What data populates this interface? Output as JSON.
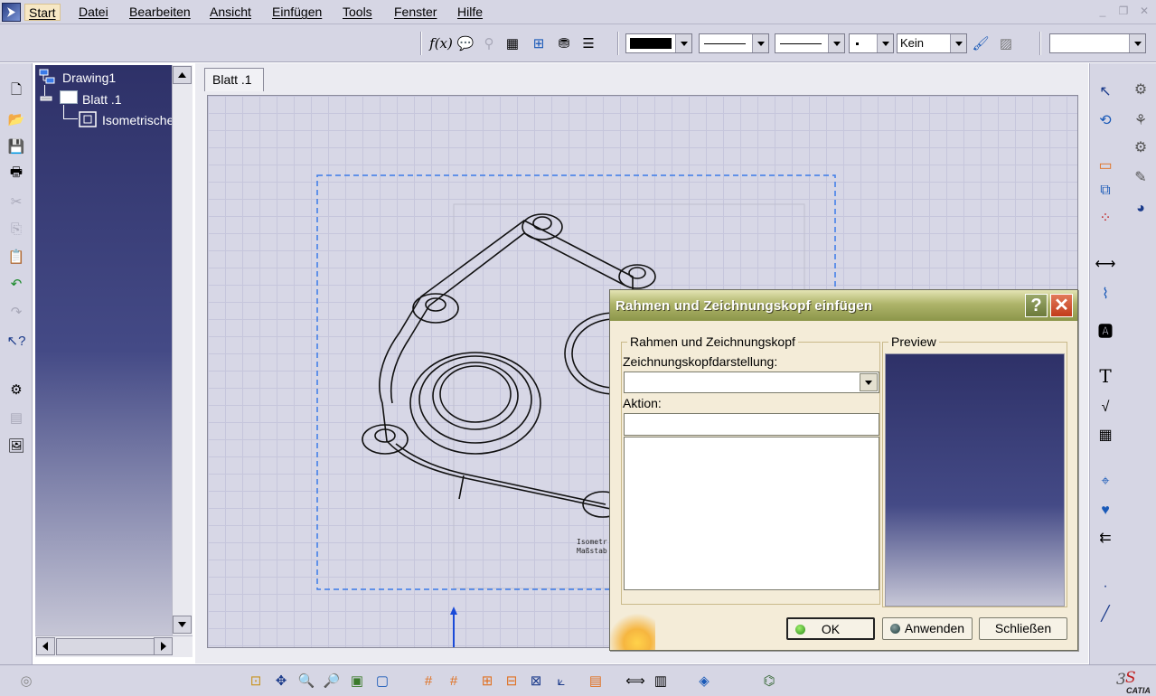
{
  "menubar": {
    "items": [
      "Start",
      "Datei",
      "Bearbeiten",
      "Ansicht",
      "Einfügen",
      "Tools",
      "Fenster",
      "Hilfe"
    ]
  },
  "toolbar": {
    "linetype_value": "Kein",
    "line_color": "#000000"
  },
  "tree": {
    "root": "Drawing1",
    "sheet": "Blatt .1",
    "view": "Isometrische"
  },
  "document": {
    "sheet_tab": "Blatt .1",
    "view_caption_line1": "Isometr",
    "view_caption_line2": "Maßstab"
  },
  "dialog": {
    "title": "Rahmen und Zeichnungskopf einfügen",
    "help_glyph": "?",
    "close_glyph": "✕",
    "group_label": "Rahmen und Zeichnungskopf",
    "titleblock_label": "Zeichnungskopfdarstellung:",
    "titleblock_value": "",
    "action_label": "Aktion:",
    "action_value": "",
    "preview_label": "Preview",
    "ok_label": "OK",
    "apply_label": "Anwenden",
    "close_label": "Schließen"
  },
  "colors": {
    "ui_face": "#d6d6e4",
    "tree_bg": "#2e3168",
    "dialog_bg": "#f4ecd8",
    "dialog_title": "#8c964a",
    "close_red": "#c23a1a",
    "frame_dash": "#3a7ae8"
  },
  "brand": {
    "logo_text": "CATIA"
  }
}
